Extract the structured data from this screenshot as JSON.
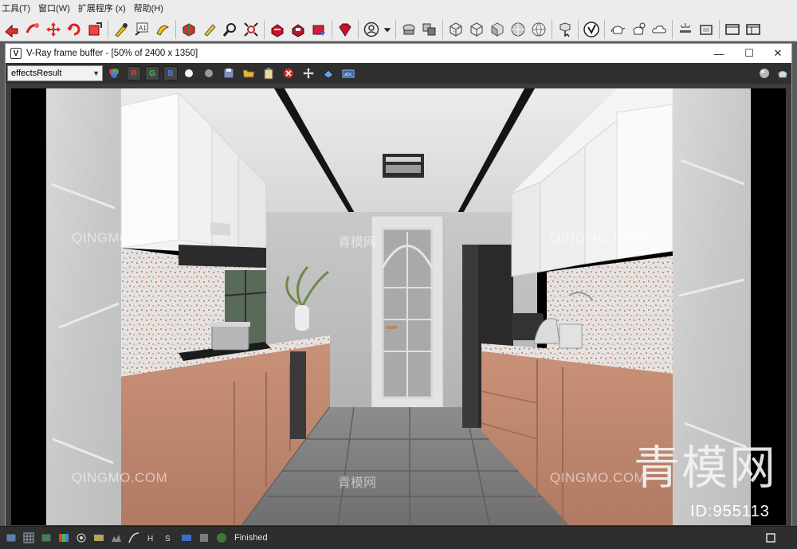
{
  "menu": {
    "items": [
      "工具(T)",
      "窗口(W)",
      "扩展程序 (x)",
      "帮助(H)"
    ]
  },
  "toolbar": {
    "icons": [
      "redo-icon",
      "link-icon",
      "select-move-icon",
      "rotate-icon",
      "scale-icon",
      "snap-icon",
      "text-icon",
      "paint-icon",
      "material-icon",
      "brush-icon",
      "zoom-icon",
      "fit-icon",
      "render-teapot-icon",
      "render-frame-icon",
      "render-env-icon",
      "gem-icon",
      "user-icon",
      "shapes-icon",
      "layers-icon",
      "box-wire-icon",
      "box-icon",
      "box-shaded-icon",
      "sphere-icon",
      "globe-icon",
      "select-hand-icon",
      "vray-logo-icon",
      "teapot-icon",
      "teapot-lights-icon",
      "cloud-icon",
      "light-icon",
      "frame-icon",
      "window-icon",
      "layout-icon"
    ]
  },
  "vfb": {
    "logo": "V",
    "title": "V-Ray frame buffer - [50% of 2400 x 1350]",
    "controls": {
      "minimize": "—",
      "maximize": "☐",
      "close": "✕"
    },
    "channel": "effectsResult",
    "channel_buttons": [
      {
        "label": "R",
        "color": "#e23b3b"
      },
      {
        "label": "G",
        "color": "#3ec24a"
      },
      {
        "label": "B",
        "color": "#4a7ce8"
      }
    ]
  },
  "render": {
    "description_id": "ID:955113",
    "watermark_cn": "青模网",
    "watermark_domain": "QINGMO.COM",
    "watermark_small_cn": "青模网"
  },
  "status": {
    "text": "Finished"
  }
}
